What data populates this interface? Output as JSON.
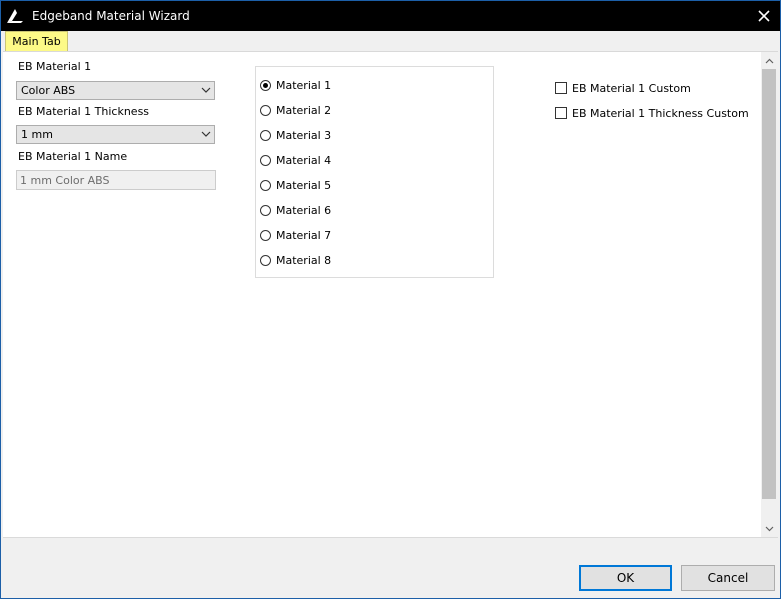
{
  "window": {
    "title": "Edgeband Material Wizard",
    "accent": "#1c5fa8"
  },
  "tabs": [
    {
      "label": "Main Tab",
      "active": true,
      "color": "#fdfa87"
    }
  ],
  "form": {
    "material_label": "EB Material 1",
    "material_value": "Color ABS",
    "thickness_label": "EB Material 1 Thickness",
    "thickness_value": "1 mm",
    "name_label": "EB Material 1 Name",
    "name_value": "1 mm Color ABS"
  },
  "materials": {
    "selected_index": 0,
    "options": [
      "Material 1",
      "Material 2",
      "Material 3",
      "Material 4",
      "Material 5",
      "Material 6",
      "Material 7",
      "Material 8"
    ]
  },
  "checkboxes": [
    {
      "label": "EB Material 1 Custom",
      "checked": false
    },
    {
      "label": "EB Material 1 Thickness Custom",
      "checked": false
    }
  ],
  "buttons": {
    "ok": "OK",
    "cancel": "Cancel"
  },
  "icons": {
    "app": "edgeband-app-icon",
    "close": "close-icon",
    "dropdown": "chevron-down-icon",
    "scroll_up": "chevron-up-icon",
    "scroll_down": "chevron-down-icon"
  }
}
